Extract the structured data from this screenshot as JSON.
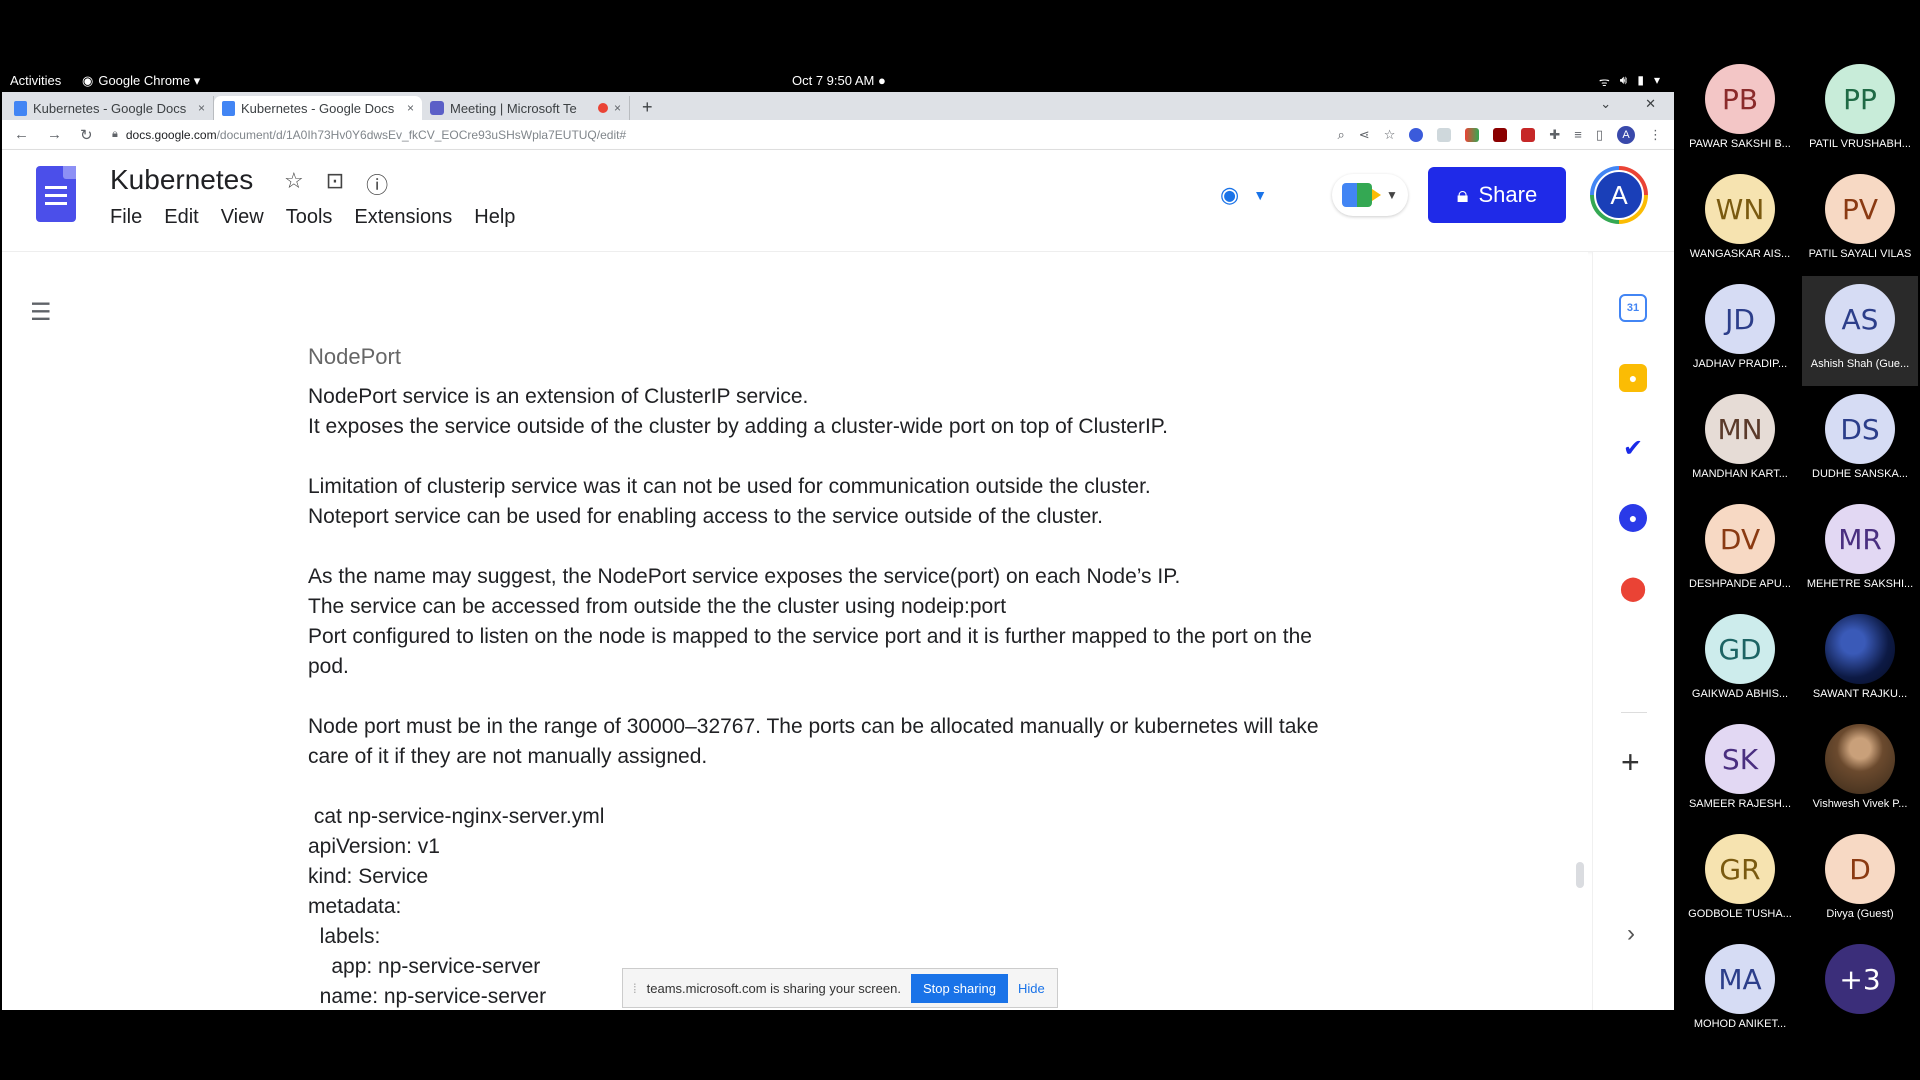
{
  "gnome": {
    "activities": "Activities",
    "app": "Google Chrome ▾",
    "clock": "Oct 7  9:50 AM ●"
  },
  "tabs": [
    {
      "label": "Kubernetes - Google Docs",
      "close": "×"
    },
    {
      "label": "Kubernetes - Google Docs",
      "close": "×"
    },
    {
      "label": "Meeting | Microsoft Te",
      "close": "×"
    }
  ],
  "tabbar": {
    "new_tab": "+",
    "dropdown": "⌄",
    "close_window": "✕"
  },
  "address": {
    "host": "docs.google.com",
    "path": "/document/d/1A0Ih73Hv0Y6dwsEv_fkCV_EOCre93uSHsWpla7EUTUQ/edit#"
  },
  "docs": {
    "title": "Kubernetes",
    "menus": [
      "File",
      "Edit",
      "View",
      "Tools",
      "Extensions",
      "Help"
    ],
    "share_label": "Share",
    "account_initial": "A"
  },
  "document": {
    "heading": "NodePort",
    "lines": [
      "NodePort service is an extension of ClusterIP service.",
      "It exposes the service outside of the cluster by adding a cluster-wide port on top of ClusterIP.",
      "",
      "Limitation of clusterip service was it can not be used for communication outside the cluster.",
      "Noteport service can be used for enabling access to the service outside of the cluster.",
      "",
      "As the name may suggest, the NodePort service exposes the service(port) on each Node’s IP.",
      "The service can be accessed from outside the the cluster using nodeip:port",
      "Port configured to listen on the node is mapped to the service port and it is further mapped to the port on the pod.",
      "",
      "Node port must be in the range of 30000–32767. The ports can be allocated manually or kubernetes will take care of it if they are not manually assigned.",
      ""
    ],
    "code_lines": [
      " cat np-service-nginx-server.yml",
      "apiVersion: v1",
      "kind: Service",
      "metadata:",
      "  labels:",
      "    app: np-service-server",
      "  name: np-service-server"
    ]
  },
  "sharebar": {
    "message": "teams.microsoft.com is sharing your screen.",
    "stop": "Stop sharing",
    "hide": "Hide"
  },
  "participants": [
    {
      "initials": "PB",
      "name": "PAWAR SAKSHI B...",
      "bg": "#f3c6c6",
      "fg": "#8a2a2a"
    },
    {
      "initials": "PP",
      "name": "PATIL VRUSHABH...",
      "bg": "#c8ecd9",
      "fg": "#1f6a45"
    },
    {
      "initials": "WN",
      "name": "WANGASKAR AIS...",
      "bg": "#f6e3b0",
      "fg": "#7a5a10"
    },
    {
      "initials": "PV",
      "name": "PATIL SAYALI VILAS",
      "bg": "#f7d9c4",
      "fg": "#8a3a12"
    },
    {
      "initials": "JD",
      "name": "JADHAV  PRADIP...",
      "bg": "#d6dcf4",
      "fg": "#2c3e8a"
    },
    {
      "initials": "AS",
      "name": "Ashish Shah (Gue...",
      "bg": "#d6dcf4",
      "fg": "#2c3e8a"
    },
    {
      "initials": "MN",
      "name": "MANDHAN  KART...",
      "bg": "#e6dcd6",
      "fg": "#5a3a2a"
    },
    {
      "initials": "DS",
      "name": "DUDHE SANSKA...",
      "bg": "#d6dcf4",
      "fg": "#2c3e8a"
    },
    {
      "initials": "DV",
      "name": "DESHPANDE APU...",
      "bg": "#f7d9c4",
      "fg": "#8a3a12"
    },
    {
      "initials": "MR",
      "name": "MEHETRE SAKSHI...",
      "bg": "#e2d8f3",
      "fg": "#4a2f80"
    },
    {
      "initials": "GD",
      "name": "GAIKWAD ABHIS...",
      "bg": "#cdecec",
      "fg": "#1d6464"
    },
    {
      "initials": "",
      "name": "SAWANT RAJKU...",
      "bg": "",
      "fg": ""
    },
    {
      "initials": "SK",
      "name": "SAMEER RAJESH...",
      "bg": "#e2d8f3",
      "fg": "#4a2f80"
    },
    {
      "initials": "",
      "name": "Vishwesh Vivek P...",
      "bg": "",
      "fg": ""
    },
    {
      "initials": "GR",
      "name": "GODBOLE TUSHA...",
      "bg": "#f6e3b0",
      "fg": "#7a5a10"
    },
    {
      "initials": "D",
      "name": "Divya (Guest)",
      "bg": "#f7d9c4",
      "fg": "#8a3a12"
    },
    {
      "initials": "MA",
      "name": "MOHOD ANIKET...",
      "bg": "#d6dcf4",
      "fg": "#2c3e8a"
    },
    {
      "initials": "+3",
      "name": "",
      "bg": "#3b2e7a",
      "fg": "#ffffff"
    }
  ],
  "colors": {
    "share_button": "#1f2ae8",
    "docs_blue": "#4b4fea",
    "teams_purple": "#5b5fc7",
    "stop_sharing": "#1a73e8"
  }
}
